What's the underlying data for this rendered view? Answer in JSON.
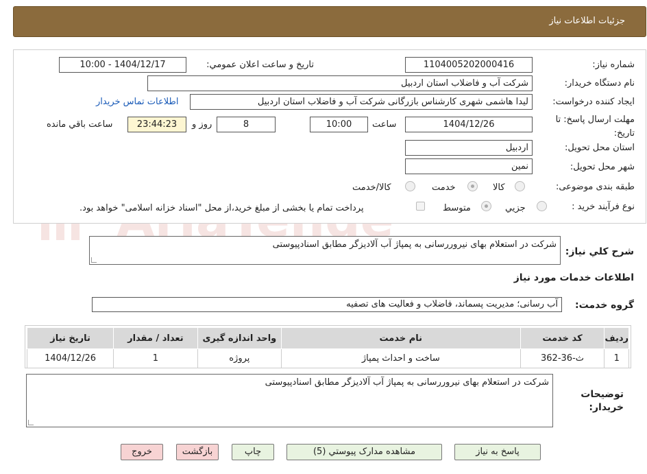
{
  "header": {
    "title": "جزئيات اطلاعات نياز"
  },
  "form": {
    "need_number_label": "شماره نياز:",
    "need_number_value": "1104005202000416",
    "announce_label": "تاريخ و ساعت اعلان عمومي:",
    "announce_value": "1404/12/17 - 10:00",
    "buyer_org_label": "نام دستگاه خريدار:",
    "buyer_org_value": "شرکت آب و فاضلاب استان اردبيل",
    "requester_label": "ايجاد کننده درخواست:",
    "requester_value": "ليدا  هاشمی شهری کارشناس بازرگانی شرکت آب و فاضلاب استان اردبیل",
    "contact_link": "اطلاعات تماس خريدار",
    "deadline_label": "مهلت ارسال پاسخ: تا تاريخ:",
    "deadline_date": "1404/12/26",
    "time_label": "ساعت",
    "deadline_time": "10:00",
    "days_value": "8",
    "days_label": "روز و",
    "remaining_time": "23:44:23",
    "remaining_label": "ساعت باقي مانده",
    "province_label": "استان محل تحويل:",
    "province_value": "اردبيل",
    "city_label": "شهر محل تحويل:",
    "city_value": "نمين",
    "category_label": "طبقه بندی موضوعی:",
    "category_options": [
      "کالا",
      "خدمت",
      "کالا/خدمت"
    ],
    "category_selected": "خدمت",
    "process_label": "نوع فرآيند خريد :",
    "process_options": [
      "جزيي",
      "متوسط"
    ],
    "process_selected": "متوسط",
    "payment_note": "پرداخت تمام يا بخشی از مبلغ خريد،از محل \"اسناد خزانه اسلامی\" خواهد بود."
  },
  "description": {
    "label": "شرح کلي نياز:",
    "value": "شرکت در استعلام بهای نیروررسانی به پمپاژ آب آلادیزگر مطابق اسنادپیوستی"
  },
  "services": {
    "section_title": "اطلاعات خدمات مورد نياز",
    "group_label": "گروه خدمت:",
    "group_value": "آب رسانی؛ مديريت پسماند، فاضلاب و فعاليت های تصفيه",
    "columns": [
      "رديف",
      "کد خدمت",
      "نام خدمت",
      "واحد اندازه گيری",
      "تعداد / مقدار",
      "تاريخ نياز"
    ],
    "rows": [
      [
        "1",
        "ث-36-362",
        "ساخت و احداث پمپاژ",
        "پروژه",
        "1",
        "1404/12/26"
      ]
    ]
  },
  "buyer_notes": {
    "label_line1": "توضيحات",
    "label_line2": "خريدار:",
    "value": "شرکت در استعلام بهای نیروررسانی به پمپاژ آب آلادیزگر مطابق اسنادپیوستی"
  },
  "buttons": {
    "reply": "پاسخ به نياز",
    "view_docs": "مشاهده مدارک پيوستي (5)",
    "print": "چاپ",
    "back": "بازگشت",
    "exit": "خروج"
  },
  "watermark": {
    "text": "AriaTender.neT"
  },
  "colors": {
    "header_bg": "#8b6b3d",
    "link": "#1a5bb8",
    "button_green": "#e8f3e0",
    "button_pink": "#f7d3d3"
  }
}
